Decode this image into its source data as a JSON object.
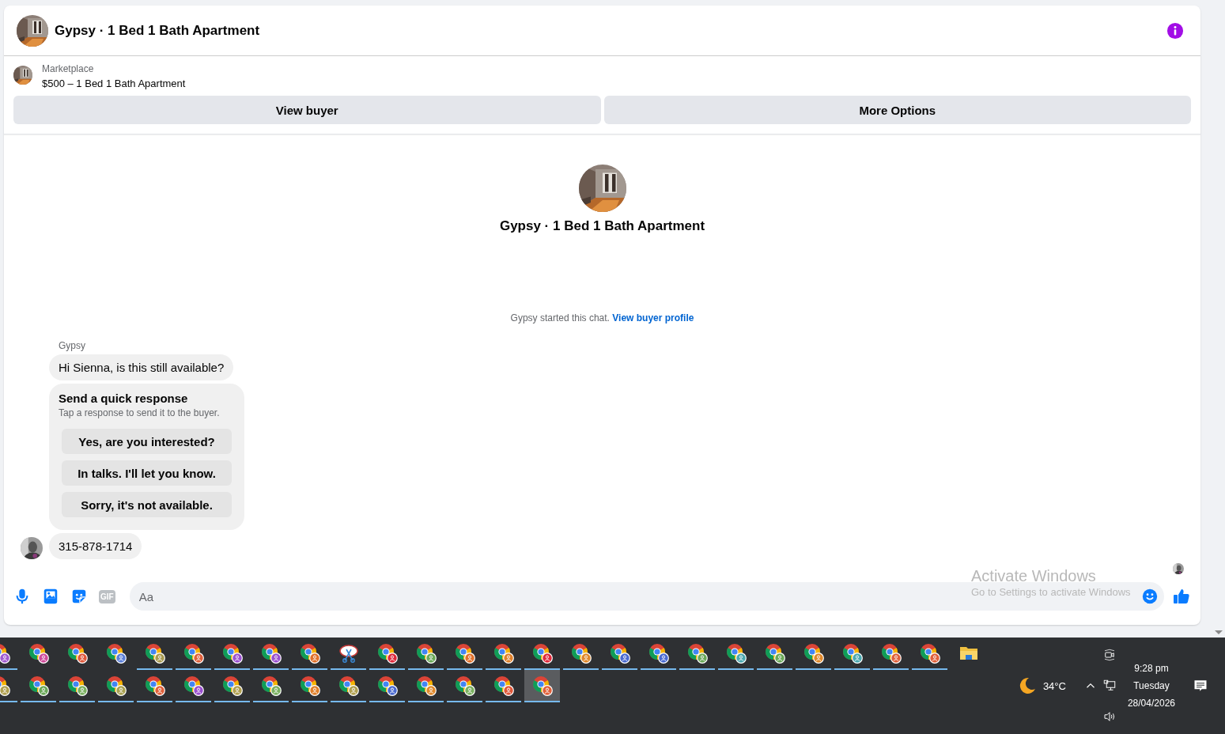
{
  "conversation": {
    "title": "Gypsy · 1 Bed 1 Bath Apartment"
  },
  "listing": {
    "label": "Marketplace",
    "title": "$500 – 1 Bed 1 Bath Apartment",
    "buttons": [
      "View buyer",
      "More Options"
    ]
  },
  "chat_header": {
    "title": "Gypsy · 1 Bed 1 Bath Apartment"
  },
  "system_notice": {
    "text": "Gypsy started this chat.",
    "link": "View buyer profile"
  },
  "messages": [
    {
      "kind": "text",
      "sender": "Gypsy",
      "text": "Hi Sienna, is this still available?",
      "avatar": false
    },
    {
      "kind": "quick_responses",
      "title": "Send a quick response",
      "subtitle": "Tap a response to send it to the buyer.",
      "options": [
        "Yes, are you interested?",
        "In talks. I'll let you know.",
        "Sorry, it's not available."
      ]
    },
    {
      "kind": "text",
      "text": "315-878-1714",
      "avatar": true
    }
  ],
  "composer": {
    "gif_label": "GIF",
    "placeholder": "Aa"
  },
  "os_overlay": {
    "title": "Activate Windows",
    "subtitle": "Go to Settings to activate Windows"
  },
  "taskbar": {
    "rows": [
      [
        {
          "kind": "chrome",
          "color": "#a05ad0",
          "running": true,
          "selected": false
        },
        {
          "kind": "chrome",
          "color": "#d04a9a",
          "running": false,
          "selected": false
        },
        {
          "kind": "chrome",
          "color": "#e0583a",
          "running": false,
          "selected": false
        },
        {
          "kind": "chrome",
          "color": "#5a7ed8",
          "running": false,
          "selected": false
        },
        {
          "kind": "chrome",
          "color": "#a89a50",
          "running": true,
          "selected": false
        },
        {
          "kind": "chrome",
          "color": "#e0603a",
          "running": true,
          "selected": false
        },
        {
          "kind": "chrome",
          "color": "#9a50d0",
          "running": true,
          "selected": false
        },
        {
          "kind": "chrome",
          "color": "#9a50d0",
          "running": true,
          "selected": false
        },
        {
          "kind": "chrome",
          "color": "#e0702a",
          "running": true,
          "selected": false
        },
        {
          "kind": "snip",
          "running": true,
          "selected": false
        },
        {
          "kind": "chrome",
          "color": "#e0283a",
          "running": true,
          "selected": false
        },
        {
          "kind": "chrome",
          "color": "#6aa858",
          "running": true,
          "selected": false
        },
        {
          "kind": "chrome",
          "color": "#e0702a",
          "running": true,
          "selected": false
        },
        {
          "kind": "chrome",
          "color": "#e0802a",
          "running": true,
          "selected": false
        },
        {
          "kind": "chrome",
          "color": "#e0283a",
          "running": true,
          "selected": false
        },
        {
          "kind": "chrome",
          "color": "#e0882a",
          "running": true,
          "selected": false
        },
        {
          "kind": "chrome",
          "color": "#4a6ad0",
          "running": true,
          "selected": false
        },
        {
          "kind": "chrome",
          "color": "#4a6ad0",
          "running": true,
          "selected": false
        },
        {
          "kind": "chrome",
          "color": "#6aa858",
          "running": true,
          "selected": false
        },
        {
          "kind": "chrome",
          "color": "#4aa8b0",
          "running": true,
          "selected": false
        },
        {
          "kind": "chrome",
          "color": "#6aa858",
          "running": true,
          "selected": false
        },
        {
          "kind": "chrome",
          "color": "#e0882a",
          "running": true,
          "selected": false
        },
        {
          "kind": "chrome",
          "color": "#4aa8b0",
          "running": true,
          "selected": false
        },
        {
          "kind": "chrome",
          "color": "#e0603a",
          "running": true,
          "selected": false
        },
        {
          "kind": "chrome",
          "color": "#e0603a",
          "running": true,
          "selected": false
        },
        {
          "kind": "folder",
          "running": false,
          "selected": false
        }
      ],
      [
        {
          "kind": "chrome",
          "color": "#b0a050",
          "running": true,
          "selected": false
        },
        {
          "kind": "chrome",
          "color": "#6aa858",
          "running": true,
          "selected": false
        },
        {
          "kind": "chrome",
          "color": "#7ab060",
          "running": true,
          "selected": false
        },
        {
          "kind": "chrome",
          "color": "#a8a050",
          "running": true,
          "selected": false
        },
        {
          "kind": "chrome",
          "color": "#e0603a",
          "running": true,
          "selected": false
        },
        {
          "kind": "chrome",
          "color": "#9a50d0",
          "running": true,
          "selected": false
        },
        {
          "kind": "chrome",
          "color": "#b0a050",
          "running": true,
          "selected": false
        },
        {
          "kind": "chrome",
          "color": "#7ab060",
          "running": true,
          "selected": false
        },
        {
          "kind": "chrome",
          "color": "#e0802a",
          "running": true,
          "selected": false
        },
        {
          "kind": "chrome",
          "color": "#b0a050",
          "running": true,
          "selected": false
        },
        {
          "kind": "chrome",
          "color": "#4a6ad0",
          "running": true,
          "selected": false
        },
        {
          "kind": "chrome",
          "color": "#e0882a",
          "running": true,
          "selected": false
        },
        {
          "kind": "chrome",
          "color": "#7ab060",
          "running": true,
          "selected": false
        },
        {
          "kind": "chrome",
          "color": "#e0583a",
          "running": true,
          "selected": false
        },
        {
          "kind": "chrome",
          "color": "#e0603a",
          "running": true,
          "selected": true
        }
      ]
    ],
    "weather": {
      "temp": "34°C"
    },
    "clock": {
      "time": "9:28 pm",
      "day": "Tuesday",
      "date": "28/04/2026"
    }
  }
}
